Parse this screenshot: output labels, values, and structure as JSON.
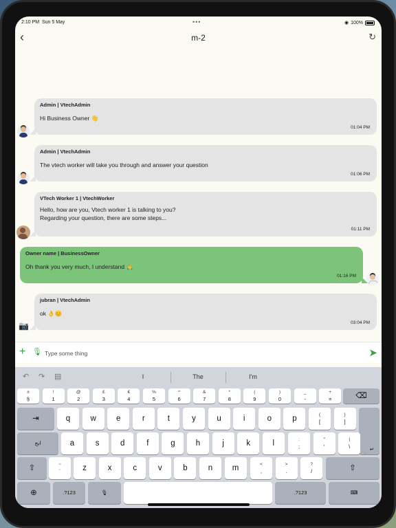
{
  "status": {
    "time": "2:10 PM",
    "date": "Sun 5 May",
    "dots": "•••",
    "battery": "100%"
  },
  "header": {
    "title": "m-2",
    "back_icon": "chevron-left-icon",
    "refresh_icon": "refresh-icon"
  },
  "messages": [
    {
      "sender": "Admin | VtechAdmin",
      "lines": [
        "Hi Business Owner 👋"
      ],
      "time": "01:04 PM"
    },
    {
      "sender": "Admin | VtechAdmin",
      "lines": [
        "The vtech worker will take you through and answer your question"
      ],
      "time": "01:06 PM"
    },
    {
      "sender": "VTech Worker 1 | VtechWorker",
      "lines": [
        "Hello, how are you, Vtech worker 1 is talking to you?",
        "Regarding your question, there are some steps..."
      ],
      "time": "01:11 PM"
    },
    {
      "sender": "Owner name | BusinessOwner",
      "lines": [
        "Oh thank you very much, I understand 🙏"
      ],
      "time": "01:16 PM"
    },
    {
      "sender": "jubran | VtechAdmin",
      "lines": [
        "ok 👌😊"
      ],
      "time": "03:04 PM"
    }
  ],
  "compose": {
    "placeholder": "Type some thing"
  },
  "colors": {
    "outgoing": "#7cc47a",
    "incoming": "#e4e4e4",
    "accent": "#3aa04a"
  },
  "keyboard": {
    "suggestions": [
      "I",
      "The",
      "I'm"
    ],
    "number_row": [
      [
        "±",
        "§"
      ],
      [
        "!",
        "1"
      ],
      [
        "@",
        "2"
      ],
      [
        "£",
        "3"
      ],
      [
        "€",
        "4"
      ],
      [
        "%",
        "5"
      ],
      [
        "^",
        "6"
      ],
      [
        "&",
        "7"
      ],
      [
        "*",
        "8"
      ],
      [
        "(",
        "9"
      ],
      [
        ")",
        "0"
      ],
      [
        "_",
        "-"
      ],
      [
        "+",
        "="
      ]
    ],
    "row_q": [
      "q",
      "w",
      "e",
      "r",
      "t",
      "y",
      "u",
      "i",
      "o",
      "p"
    ],
    "row_q_extra": [
      [
        "{",
        "["
      ],
      [
        "}",
        "]"
      ]
    ],
    "row_a": [
      "a",
      "s",
      "d",
      "f",
      "g",
      "h",
      "j",
      "k",
      "l"
    ],
    "row_a_extra": [
      [
        ":",
        ";"
      ],
      [
        "″",
        "'"
      ],
      [
        "|",
        "\\"
      ]
    ],
    "row_z": [
      "z",
      "x",
      "c",
      "v",
      "b",
      "n",
      "m"
    ],
    "row_z_extra": [
      [
        "~",
        "`"
      ],
      [
        "<",
        ","
      ],
      [
        ">",
        "."
      ],
      [
        "?",
        "/"
      ]
    ],
    "lang_key": "ابج",
    "num_key": ".?123"
  }
}
